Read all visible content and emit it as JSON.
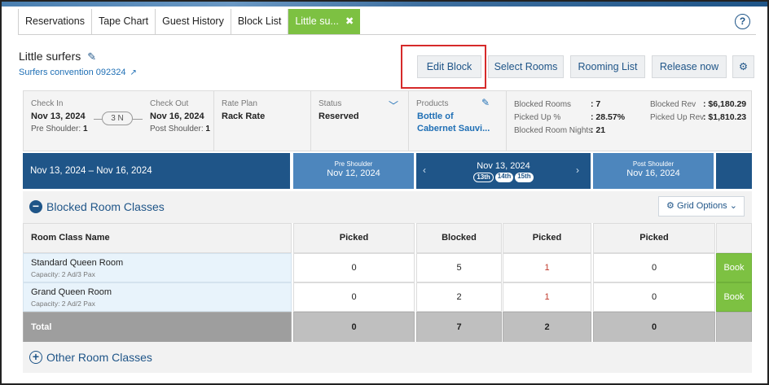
{
  "tabs": [
    {
      "label": "Reservations"
    },
    {
      "label": "Tape Chart"
    },
    {
      "label": "Guest History"
    },
    {
      "label": "Block List"
    },
    {
      "label": "Little su..."
    }
  ],
  "header": {
    "title": "Little surfers",
    "subtitle": "Surfers convention 092324",
    "help_label": "?"
  },
  "actions": {
    "edit_block": "Edit Block",
    "select_rooms": "Select Rooms",
    "rooming_list": "Rooming List",
    "release_now": "Release now"
  },
  "info": {
    "check_in_label": "Check In",
    "check_in_date": "Nov 13, 2024",
    "pre_shoulder_label": "Pre Shoulder:",
    "pre_shoulder_value": "1",
    "nights": "3 N",
    "check_out_label": "Check Out",
    "check_out_date": "Nov 16, 2024",
    "post_shoulder_label": "Post Shoulder:",
    "post_shoulder_value": "1",
    "rate_plan_label": "Rate Plan",
    "rate_plan_value": "Rack Rate",
    "status_label": "Status",
    "status_value": "Reserved",
    "products_label": "Products",
    "products_line1": "Bottle of",
    "products_line2": "Cabernet Sauvi...",
    "blocked_rooms_label": "Blocked Rooms",
    "blocked_rooms_value": ": 7",
    "picked_up_pct_label": "Picked Up %",
    "picked_up_pct_value": ": 28.57%",
    "blocked_room_nights_label": "Blocked Room Nights",
    "blocked_room_nights_value": ": 21",
    "blocked_rev_label": "Blocked Rev",
    "blocked_rev_value": ": $6,180.29",
    "picked_up_rev_label": "Picked Up Rev",
    "picked_up_rev_value": ": $1,810.23"
  },
  "datebar": {
    "range": "Nov 13, 2024 – Nov 16, 2024",
    "pre_label": "Pre Shoulder",
    "pre_date": "Nov 12, 2024",
    "current_date": "Nov 13, 2024",
    "day_pills": [
      "13th",
      "14th",
      "15th"
    ],
    "post_label": "Post Shoulder",
    "post_date": "Nov 16, 2024"
  },
  "blocked_section": {
    "title": "Blocked Room Classes",
    "grid_options": "Grid Options"
  },
  "table": {
    "headers": [
      "Room Class Name",
      "Picked",
      "Blocked",
      "Picked",
      "Picked"
    ],
    "rows": [
      {
        "name": "Standard Queen Room",
        "capacity": "Capacity: 2 Ad/3 Pax",
        "pre_picked": "0",
        "blocked": "5",
        "picked": "1",
        "post_picked": "0",
        "book": "Book"
      },
      {
        "name": "Grand Queen Room",
        "capacity": "Capacity: 2 Ad/2 Pax",
        "pre_picked": "0",
        "blocked": "2",
        "picked": "1",
        "post_picked": "0",
        "book": "Book"
      }
    ],
    "total": {
      "label": "Total",
      "pre_picked": "0",
      "blocked": "7",
      "picked": "2",
      "post_picked": "0"
    }
  },
  "other_section": {
    "title": "Other Room Classes"
  },
  "colors": {
    "primary_blue": "#1f5588",
    "shoulder_blue": "#4d86bd",
    "book_green": "#7dc142",
    "highlight_red": "#d62a2a"
  }
}
